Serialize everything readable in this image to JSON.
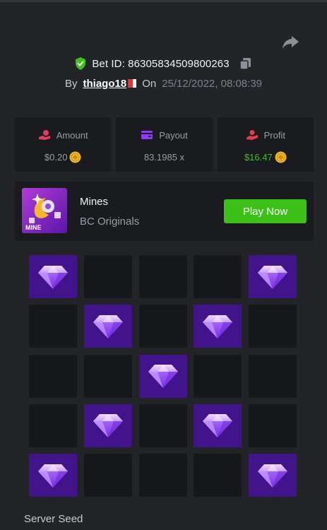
{
  "header": {
    "share_icon": "share-arrow-icon",
    "bet_label": "Bet ID:",
    "bet_id": "86305834509800263",
    "verified_icon": "shield-check-icon",
    "verified_color": "#3bc117",
    "copy_icon": "copy-icon",
    "by_label": "By",
    "username": "thiago18",
    "flag_icon": "peru-flag-icon",
    "on_label": "On",
    "date": "25/12/2022, 08:08:39"
  },
  "stats": {
    "amount": {
      "label": "Amount",
      "value": "$0.20",
      "icon": "coins-hand-icon"
    },
    "payout": {
      "label": "Payout",
      "value": "83.1985 x",
      "icon": "wallet-icon"
    },
    "profit": {
      "label": "Profit",
      "value": "$16.47",
      "icon": "profit-hand-icon"
    },
    "currency_icon": "bcd-coin-icon",
    "profit_color": "#3bc117"
  },
  "game": {
    "name": "Mines",
    "provider": "BC Originals",
    "thumb_label": "MINE",
    "play_label": "Play Now",
    "play_color": "#3bc117"
  },
  "board": {
    "rows": 5,
    "cols": 5,
    "gem_icon": "diamond-icon",
    "gem_color": "#42138b",
    "cells": [
      "gem",
      "empty",
      "empty",
      "empty",
      "gem",
      "empty",
      "gem",
      "empty",
      "gem",
      "empty",
      "empty",
      "empty",
      "gem",
      "empty",
      "empty",
      "empty",
      "gem",
      "empty",
      "gem",
      "empty",
      "gem",
      "empty",
      "empty",
      "empty",
      "gem"
    ]
  },
  "footer": {
    "server_seed_label": "Server Seed"
  }
}
